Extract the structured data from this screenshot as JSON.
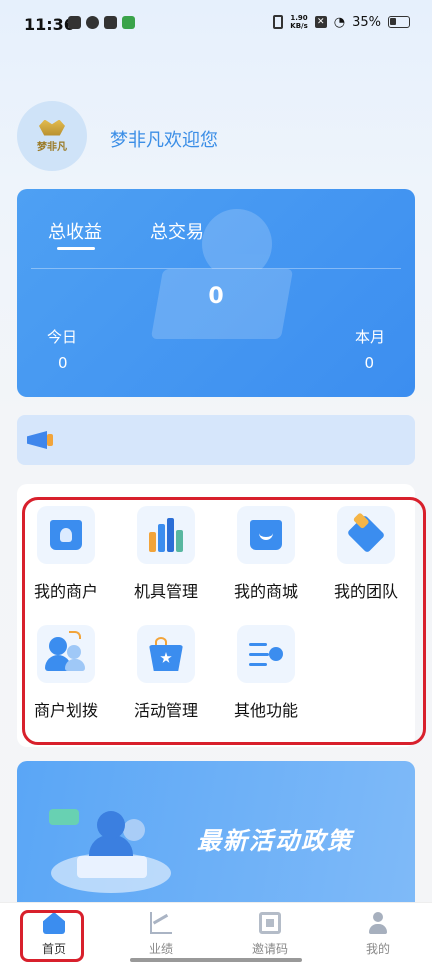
{
  "status_bar": {
    "time": "11:36",
    "net_speed_top": "1.90",
    "net_speed_unit": "KB/s",
    "battery": "35%"
  },
  "welcome": {
    "logo_text": "梦非凡",
    "greeting": "梦非凡欢迎您"
  },
  "revenue": {
    "tabs": [
      "总收益",
      "总交易"
    ],
    "total": "0",
    "today_label": "今日",
    "today_value": "0",
    "month_label": "本月",
    "month_value": "0"
  },
  "functions": [
    {
      "label": "我的商户",
      "icon": "merchant-bag-icon"
    },
    {
      "label": "机具管理",
      "icon": "device-bars-icon"
    },
    {
      "label": "我的商城",
      "icon": "shopping-bag-icon"
    },
    {
      "label": "我的团队",
      "icon": "team-handshake-icon"
    },
    {
      "label": "商户划拨",
      "icon": "transfer-people-icon"
    },
    {
      "label": "活动管理",
      "icon": "activity-basket-icon"
    },
    {
      "label": "其他功能",
      "icon": "other-functions-icon"
    }
  ],
  "banner": {
    "title": "最新活动政策"
  },
  "tabbar": {
    "items": [
      {
        "label": "首页",
        "icon": "home-icon"
      },
      {
        "label": "业绩",
        "icon": "performance-chart-icon"
      },
      {
        "label": "邀请码",
        "icon": "qrcode-icon"
      },
      {
        "label": "我的",
        "icon": "user-icon"
      }
    ],
    "active_index": 0
  },
  "colors": {
    "primary": "#3b8def",
    "highlight_frame": "#d8202c"
  }
}
